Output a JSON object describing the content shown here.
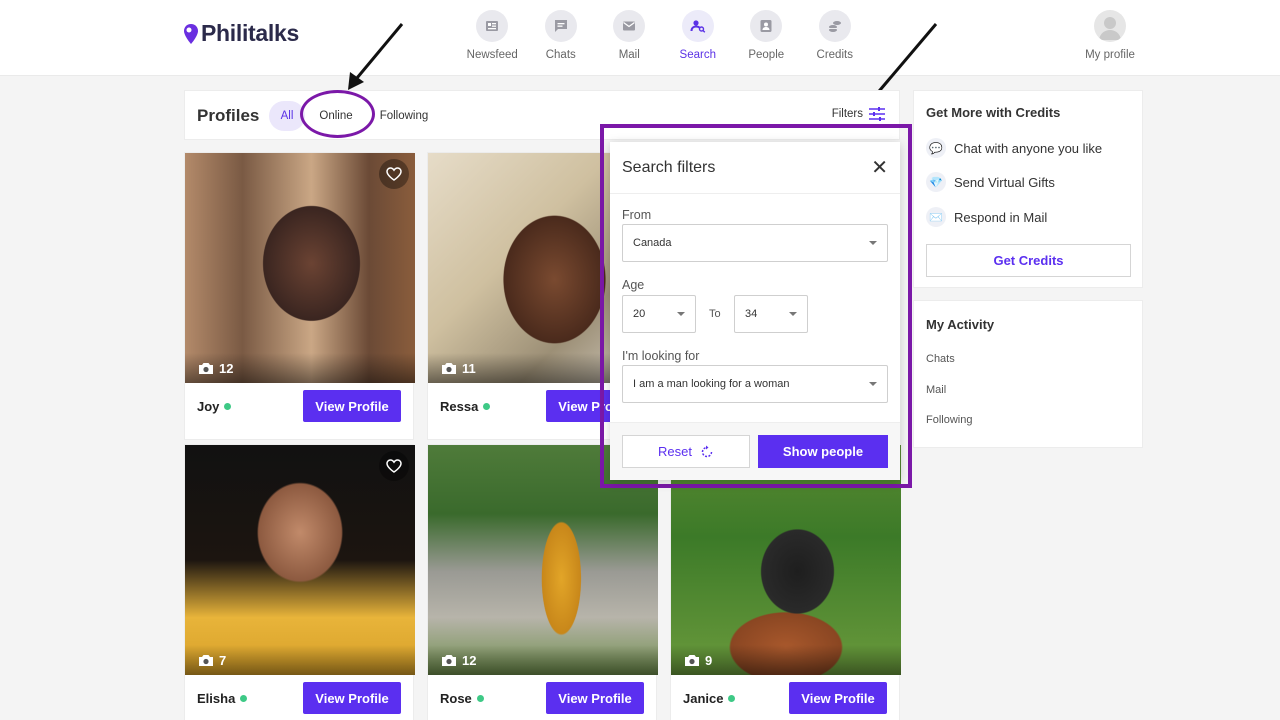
{
  "header": {
    "logo": "Philitalks",
    "nav": [
      {
        "label": "Newsfeed"
      },
      {
        "label": "Chats"
      },
      {
        "label": "Mail"
      },
      {
        "label": "Search"
      },
      {
        "label": "People"
      },
      {
        "label": "Credits"
      }
    ],
    "active_nav": "Search",
    "profile_label": "My profile"
  },
  "profiles_bar": {
    "title": "Profiles",
    "tabs": [
      "All",
      "Online",
      "Following"
    ],
    "active_tab": "All",
    "filters_label": "Filters"
  },
  "cards": [
    {
      "name": "Joy",
      "photos": "12",
      "button": "View Profile"
    },
    {
      "name": "Ressa",
      "photos": "11",
      "button": "View Profile"
    },
    {
      "name": "Elisha",
      "photos": "7",
      "button": "View Profile"
    },
    {
      "name": "Rose",
      "photos": "12",
      "button": "View Profile"
    },
    {
      "name": "Janice",
      "photos": "9",
      "button": "View Profile"
    }
  ],
  "search_filters": {
    "title": "Search filters",
    "from_label": "From",
    "from_value": "Canada",
    "age_label": "Age",
    "age_min": "20",
    "age_to": "To",
    "age_max": "34",
    "looking_label": "I'm looking for",
    "looking_value": "I am a man looking for a woman",
    "reset_label": "Reset",
    "show_label": "Show people"
  },
  "credits_panel": {
    "title": "Get More with Credits",
    "perks": [
      "Chat with anyone you like",
      "Send Virtual Gifts",
      "Respond in Mail"
    ],
    "button": "Get Credits"
  },
  "activity_panel": {
    "title": "My Activity",
    "links": [
      "Chats",
      "Mail",
      "Following"
    ]
  },
  "colors": {
    "accent": "#5b2ff0",
    "annotation": "#7b18a8",
    "online": "#3ec986"
  }
}
